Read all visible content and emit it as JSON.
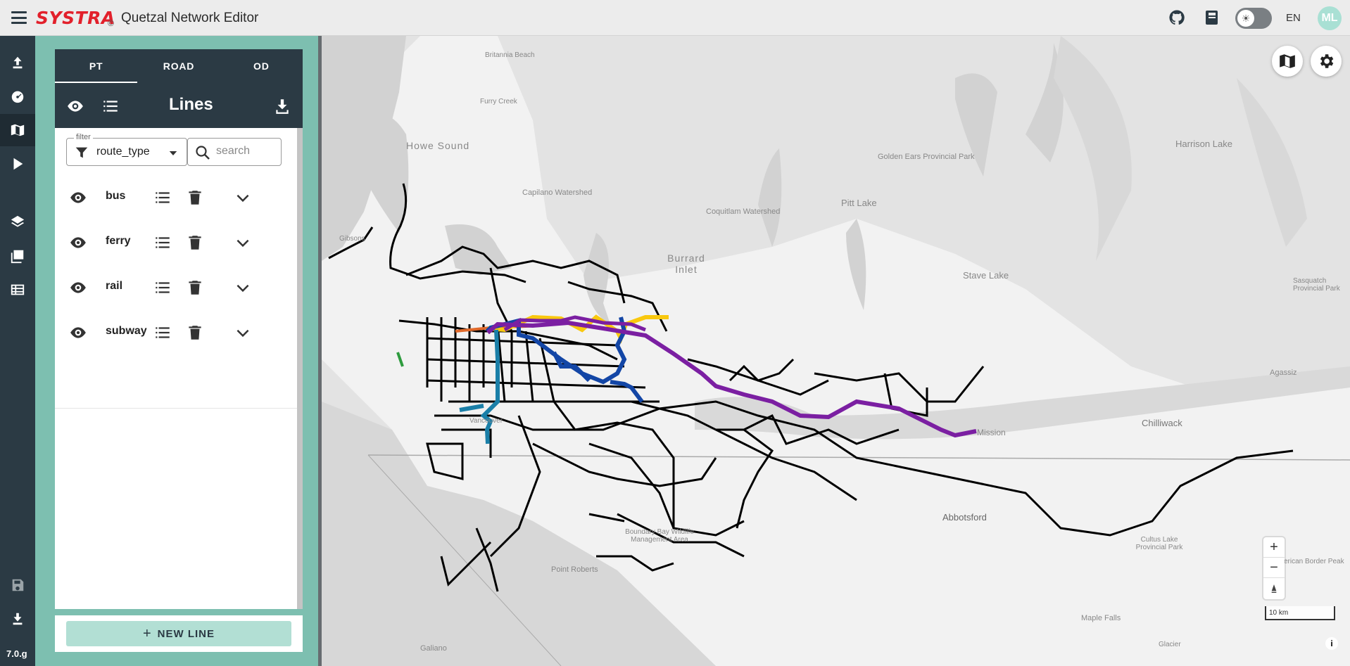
{
  "header": {
    "logo": "SYSTRA",
    "copyright": "©",
    "app_title": "Quetzal Network Editor",
    "lang": "EN",
    "avatar_initials": "ML",
    "icons": [
      "github-icon",
      "book-icon",
      "theme-toggle",
      "avatar"
    ]
  },
  "sidebar": {
    "version": "7.0.g",
    "items": [
      {
        "name": "import-icon"
      },
      {
        "name": "dashboard-icon"
      },
      {
        "name": "map-icon",
        "active": true
      },
      {
        "name": "run-icon"
      },
      {
        "name": "layers-icon"
      },
      {
        "name": "gallery-icon"
      },
      {
        "name": "table-icon"
      },
      {
        "name": "save-icon"
      },
      {
        "name": "download-icon"
      }
    ]
  },
  "panel": {
    "tabs": [
      {
        "label": "PT",
        "active": true
      },
      {
        "label": "ROAD"
      },
      {
        "label": "OD"
      }
    ],
    "title": "Lines",
    "filter": {
      "legend": "filter",
      "value": "route_type"
    },
    "search": {
      "placeholder": "search"
    },
    "groups": [
      {
        "label": "bus"
      },
      {
        "label": "ferry"
      },
      {
        "label": "rail"
      },
      {
        "label": "subway"
      }
    ],
    "new_line_label": "NEW LINE"
  },
  "map": {
    "labels": [
      {
        "text": "Britannia Beach"
      },
      {
        "text": "Furry Creek"
      },
      {
        "text": "Howe Sound"
      },
      {
        "text": "Capilano Watershed"
      },
      {
        "text": "Coquitlam Watershed"
      },
      {
        "text": "Golden Ears Provincial Park"
      },
      {
        "text": "Pitt Lake"
      },
      {
        "text": "Harrison Lake"
      },
      {
        "text": "Gibsons"
      },
      {
        "text": "Burrard Inlet"
      },
      {
        "text": "Stave Lake"
      },
      {
        "text": "Sasquatch Provincial Park"
      },
      {
        "text": "Agassiz"
      },
      {
        "text": "Mission"
      },
      {
        "text": "Chilliwack"
      },
      {
        "text": "Vancouver"
      },
      {
        "text": "Abbotsford"
      },
      {
        "text": "Boundary Bay Wildlife Management Area"
      },
      {
        "text": "Point Roberts"
      },
      {
        "text": "Cultus Lake Provincial Park"
      },
      {
        "text": "Maple Falls"
      },
      {
        "text": "Galiano"
      },
      {
        "text": "Glacier"
      },
      {
        "text": "American Border Peak"
      }
    ],
    "scale_label": "10 km",
    "colors": {
      "bus": "#000000",
      "subway_purple": "#7b1fa2",
      "subway_yellow": "#f9c80e",
      "subway_blue": "#1346a6",
      "subway_teal": "#1a7fa8",
      "rail_orange": "#e0692a"
    }
  }
}
